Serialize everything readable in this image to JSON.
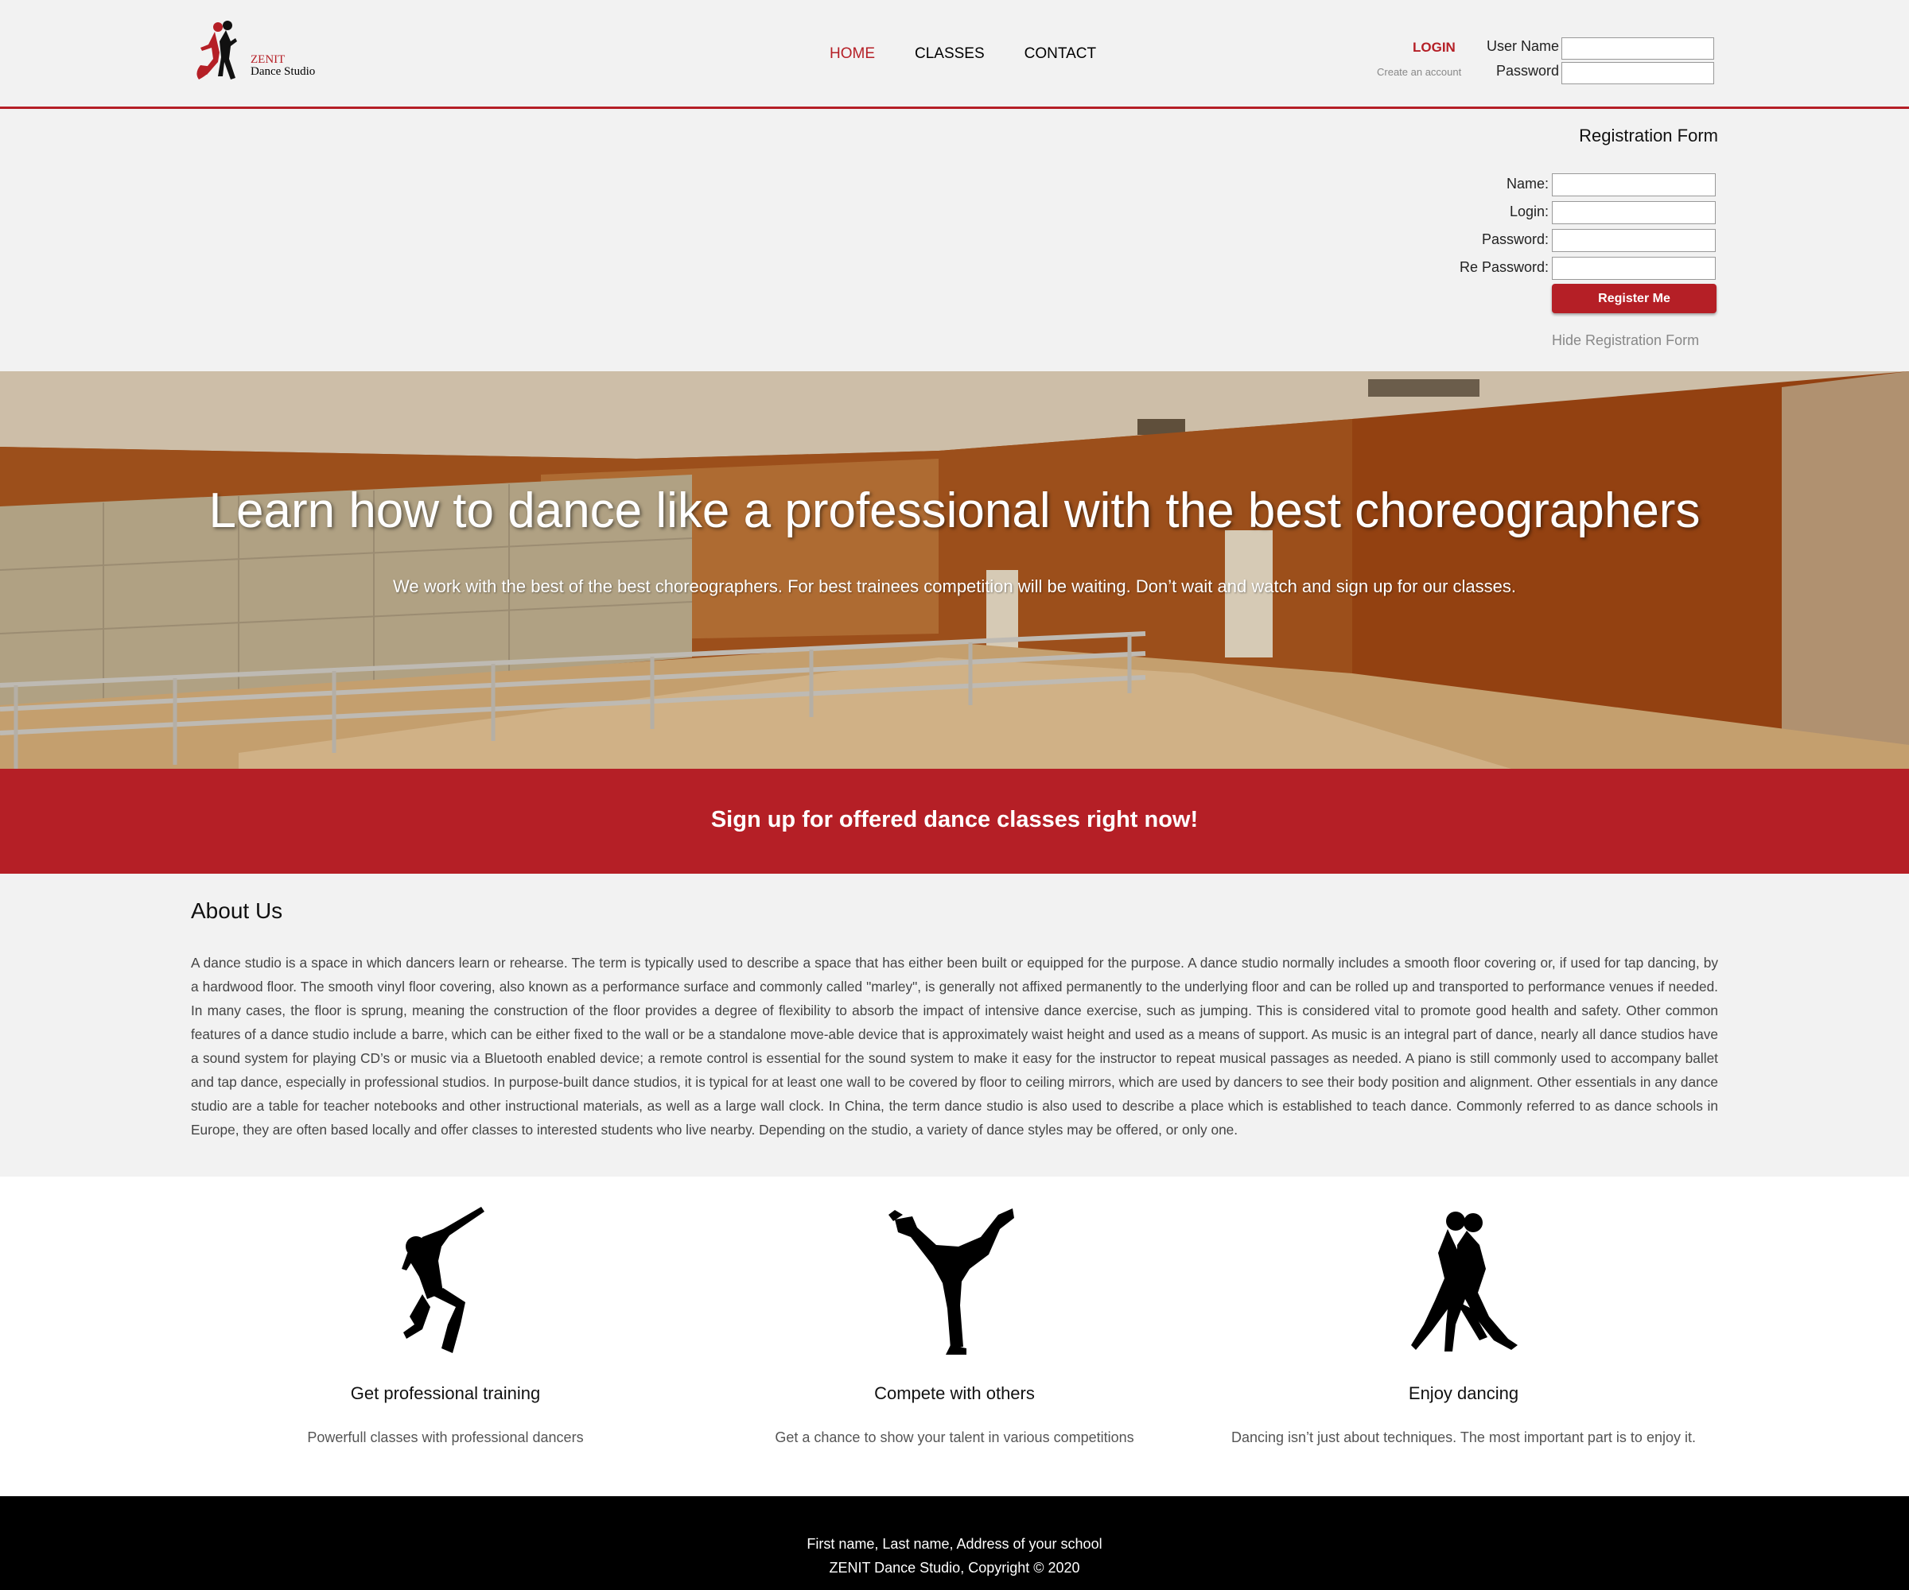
{
  "logo": {
    "line1": "ZENIT",
    "line2": "Dance Studio",
    "icon": "dancing-couple-logo"
  },
  "nav": {
    "home": "HOME",
    "classes": "CLASSES",
    "contact": "CONTACT"
  },
  "login": {
    "title": "LOGIN",
    "create_account": "Create an account",
    "username_label": "User Name",
    "password_label": "Password",
    "username_value": "",
    "password_value": ""
  },
  "registration": {
    "title": "Registration Form",
    "name_label": "Name:",
    "login_label": "Login:",
    "password_label": "Password:",
    "repassword_label": "Re Password:",
    "submit": "Register Me",
    "hide_link": "Hide Registration Form"
  },
  "hero": {
    "title": "Learn how to dance like a professional with the best choreographers",
    "subtitle": "We work with the best of the best choreographers. For best trainees competition will be waiting. Don’t wait and watch and sign up for our classes."
  },
  "cta": {
    "text": "Sign up for offered dance classes right now!"
  },
  "about": {
    "title": "About Us",
    "body": "A dance studio is a space in which dancers learn or rehearse. The term is typically used to describe a space that has either been built or equipped for the purpose. A dance studio normally includes a smooth floor covering or, if used for tap dancing, by a hardwood floor. The smooth vinyl floor covering, also known as a performance surface and commonly called \"marley\", is generally not affixed permanently to the underlying floor and can be rolled up and transported to performance venues if needed. In many cases, the floor is sprung, meaning the construction of the floor provides a degree of flexibility to absorb the impact of intensive dance exercise, such as jumping. This is considered vital to promote good health and safety. Other common features of a dance studio include a barre, which can be either fixed to the wall or be a standalone move-able device that is approximately waist height and used as a means of support. As music is an integral part of dance, nearly all dance studios have a sound system for playing CD’s or music via a Bluetooth enabled device; a remote control is essential for the sound system to make it easy for the instructor to repeat musical passages as needed. A piano is still commonly used to accompany ballet and tap dance, especially in professional studios. In purpose-built dance studios, it is typical for at least one wall to be covered by floor to ceiling mirrors, which are used by dancers to see their body position and alignment. Other essentials in any dance studio are a table for teacher notebooks and other instructional materials, as well as a large wall clock. In China, the term dance studio is also used to describe a place which is established to teach dance. Commonly referred to as dance schools in Europe, they are often based locally and offer classes to interested students who live nearby. Depending on the studio, a variety of dance styles may be offered, or only one."
  },
  "features": [
    {
      "icon": "hip-hop-dancer-icon",
      "title": "Get professional training",
      "desc": "Powerfull classes with professional dancers"
    },
    {
      "icon": "breakdancer-icon",
      "title": "Compete with others",
      "desc": "Get a chance to show your talent in various competitions"
    },
    {
      "icon": "tango-couple-icon",
      "title": "Enjoy dancing",
      "desc": "Dancing isn’t just about techniques. The most important part is to enjoy it."
    }
  ],
  "footer": {
    "line1": "First name, Last name, Address of your school",
    "line2": "ZENIT Dance Studio, Copyright © 2020"
  },
  "colors": {
    "accent": "#b51f26",
    "background": "#f2f2f2",
    "footer": "#000000"
  }
}
